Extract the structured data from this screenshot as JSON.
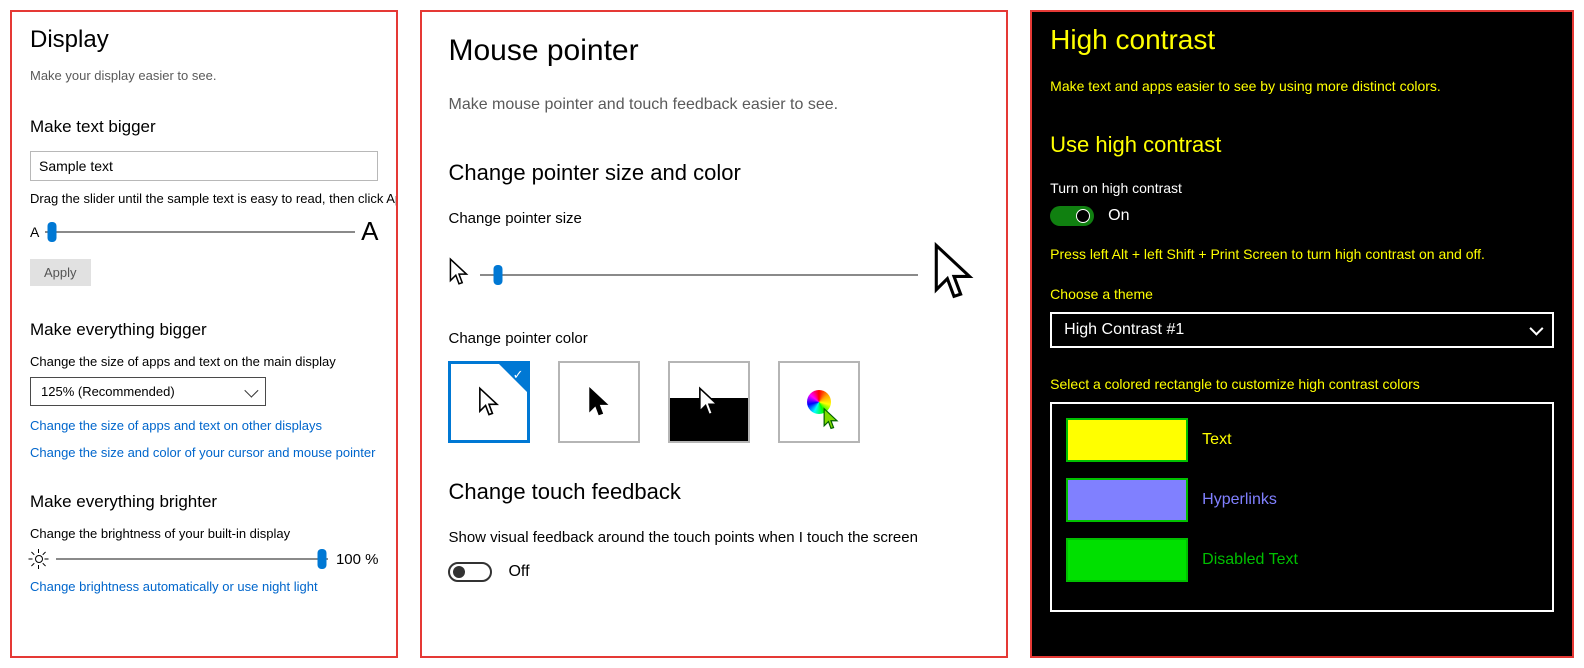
{
  "display": {
    "title": "Display",
    "subtitle": "Make your display easier to see.",
    "sec_text_bigger": "Make text bigger",
    "sample": "Sample text",
    "slider_instruction": "Drag the slider until the sample text is easy to read, then click Apply.",
    "smallA": "A",
    "bigA": "A",
    "apply": "Apply",
    "sec_everything_bigger": "Make everything bigger",
    "apps_main_label": "Change the size of apps and text on the main display",
    "scale_value": "125% (Recommended)",
    "link_other_displays": "Change the size of apps and text on other displays",
    "link_cursor": "Change the size and color of your cursor and mouse pointer",
    "sec_brighter": "Make everything brighter",
    "brightness_label": "Change the brightness of your built-in display",
    "brightness_value": "100 %",
    "link_night_light": "Change brightness automatically or use night light"
  },
  "mouse": {
    "title": "Mouse pointer",
    "subtitle": "Make mouse pointer and touch feedback easier to see.",
    "sec_change": "Change pointer size and color",
    "size_label": "Change pointer size",
    "color_label": "Change pointer color",
    "sec_touch": "Change touch feedback",
    "touch_show": "Show visual feedback around the touch points when I touch the screen",
    "off": "Off"
  },
  "hc": {
    "title": "High contrast",
    "subtitle": "Make text and apps easier to see by using more distinct colors.",
    "sec_use": "Use high contrast",
    "turn_on": "Turn on high contrast",
    "on": "On",
    "shortcut": "Press left Alt + left Shift + Print Screen to turn high contrast on and off.",
    "choose_theme": "Choose a theme",
    "theme": "High Contrast #1",
    "customize": "Select a colored rectangle to customize high contrast colors",
    "swatches": {
      "text": {
        "label": "Text",
        "color": "#ffff00"
      },
      "link": {
        "label": "Hyperlinks",
        "color": "#8080ff"
      },
      "dis": {
        "label": "Disabled Text",
        "color": "#00e000"
      }
    }
  }
}
